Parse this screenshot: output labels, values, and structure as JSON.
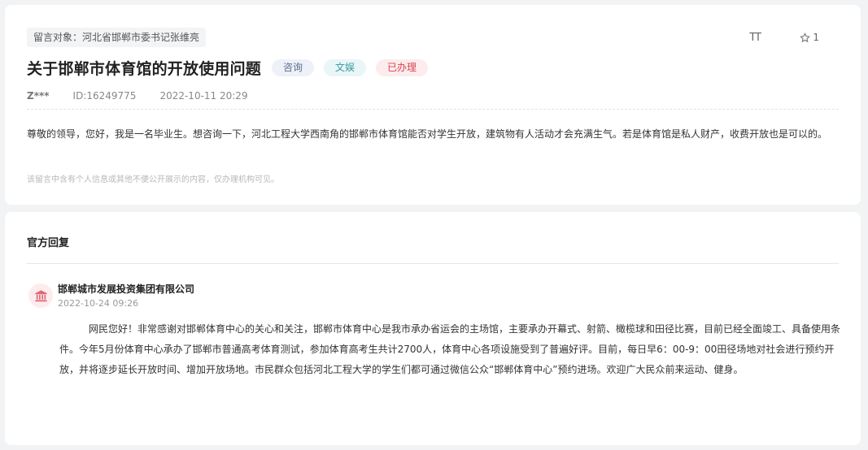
{
  "message": {
    "target_label": "留言对象：河北省邯郸市委书记张维亮",
    "font_toggle_label": "TT",
    "favorite_count": "1",
    "title": "关于邯郸市体育馆的开放使用问题",
    "tags": {
      "consult": "咨询",
      "culture": "文娱",
      "status": "已办理"
    },
    "user": "Z***",
    "id": "ID:16249775",
    "datetime": "2022-10-11 20:29",
    "body": "尊敬的领导，您好，我是一名毕业生。想咨询一下，河北工程大学西南角的邯郸市体育馆能否对学生开放，建筑物有人活动才会充满生气。若是体育馆是私人财产，收费开放也是可以的。",
    "privacy_note": "该留言中含有个人信息或其他不便公开展示的内容，仅办理机构可见。"
  },
  "reply": {
    "section_title": "官方回复",
    "org_name": "邯郸城市发展投资集团有限公司",
    "org_time": "2022-10-24 09:26",
    "body": "网民您好！非常感谢对邯郸体育中心的关心和关注，邯郸市体育中心是我市承办省运会的主场馆，主要承办开幕式、射箭、橄榄球和田径比赛，目前已经全面竣工、具备使用条件。今年5月份体育中心承办了邯郸市普通高考体育测试，参加体育高考生共计2700人，体育中心各项设施受到了普遍好评。目前，每日早6：00-9：00田径场地对社会进行预约开放，并将逐步延长开放时间、增加开放场地。市民群众包括河北工程大学的学生们都可通过微信公众“邯郸体育中心”预约进场。欢迎广大民众前来运动、健身。"
  },
  "icons": {
    "font_size": "font-size-icon",
    "favorite": "star-icon",
    "org_avatar": "bank-building-icon"
  },
  "colors": {
    "status_done": "#d9434f",
    "tag_consult": "#5b6d8f",
    "tag_culture": "#3a9aa3"
  }
}
